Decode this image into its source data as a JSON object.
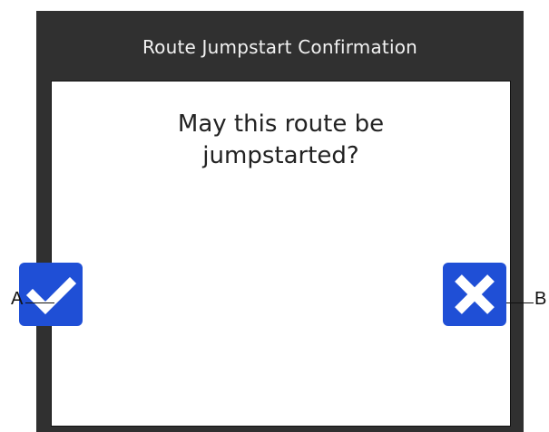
{
  "dialog": {
    "title": "Route Jumpstart Confirmation",
    "question_line1": "May this route be",
    "question_line2": "jumpstarted?",
    "confirm_icon": "checkmark-icon",
    "cancel_icon": "x-icon",
    "button_color": "#1f4fd6",
    "header_color": "#303030"
  },
  "callouts": {
    "a": "A",
    "b": "B"
  }
}
